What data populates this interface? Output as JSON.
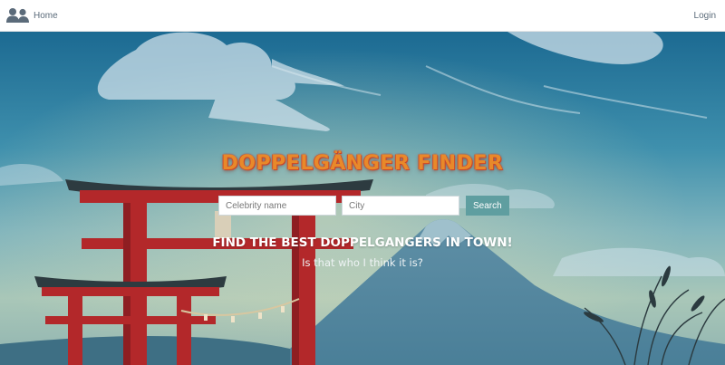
{
  "nav": {
    "home_label": "Home",
    "login_label": "Login",
    "brand_icon": "users-icon"
  },
  "hero": {
    "title": "DOPPELGÄNGER FINDER",
    "subtitle": "FIND THE BEST DOPPELGANGERS IN TOWN!",
    "tagline": "Is that who I think it is?"
  },
  "search": {
    "celebrity_placeholder": "Celebrity name",
    "city_placeholder": "City",
    "celebrity_value": "",
    "city_value": "",
    "button_label": "Search"
  },
  "colors": {
    "title": "#e8892a",
    "search_button": "#5f9ea0",
    "torii": "#b3282a",
    "sky_top": "#1f6f96"
  }
}
